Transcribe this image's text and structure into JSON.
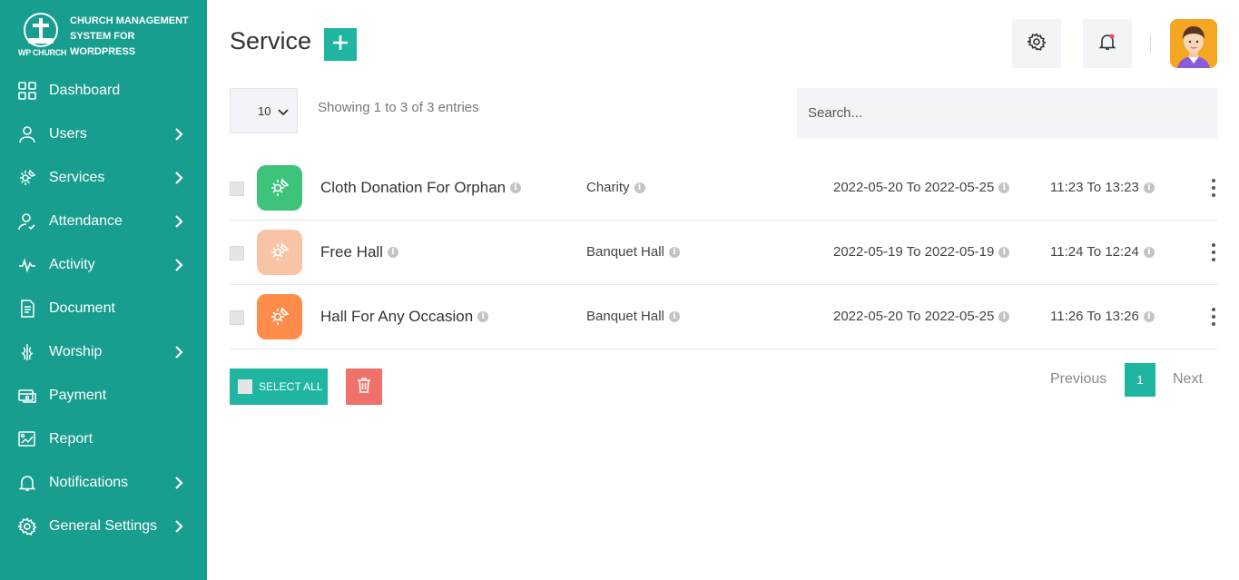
{
  "brand": {
    "logo_text": "WP CHURCH",
    "title": "CHURCH MANAGEMENT SYSTEM FOR WORDPRESS"
  },
  "sidebar": {
    "items": [
      {
        "label": "Dashboard",
        "icon": "dashboard-icon",
        "has_submenu": false
      },
      {
        "label": "Users",
        "icon": "user-icon",
        "has_submenu": true
      },
      {
        "label": "Services",
        "icon": "services-icon",
        "has_submenu": true
      },
      {
        "label": "Attendance",
        "icon": "attendance-icon",
        "has_submenu": true
      },
      {
        "label": "Activity",
        "icon": "activity-icon",
        "has_submenu": true
      },
      {
        "label": "Document",
        "icon": "document-icon",
        "has_submenu": false
      },
      {
        "label": "Worship",
        "icon": "worship-icon",
        "has_submenu": true
      },
      {
        "label": "Payment",
        "icon": "payment-icon",
        "has_submenu": false
      },
      {
        "label": "Report",
        "icon": "report-icon",
        "has_submenu": false
      },
      {
        "label": "Notifications",
        "icon": "bell-icon",
        "has_submenu": true
      },
      {
        "label": "General Settings",
        "icon": "gear-icon",
        "has_submenu": true
      }
    ]
  },
  "header": {
    "title": "Service",
    "add_icon": "plus-icon",
    "settings_icon": "gear-icon",
    "notification_icon": "bell-icon"
  },
  "table_controls": {
    "page_size": "10",
    "entries_info": "Showing 1 to 3 of 3 entries",
    "search_placeholder": "Search..."
  },
  "rows": [
    {
      "name": "Cloth Donation For Orphan",
      "category": "Charity",
      "dates": "2022-05-20 To 2022-05-25",
      "time": "11:23 To 13:23",
      "icon_color": "#3ec47a"
    },
    {
      "name": "Free Hall",
      "category": "Banquet Hall",
      "dates": "2022-05-19 To 2022-05-19",
      "time": "11:24 To 12:24",
      "icon_color": "#f9c3a5"
    },
    {
      "name": "Hall For Any Occasion",
      "category": "Banquet Hall",
      "dates": "2022-05-20 To 2022-05-25",
      "time": "11:26 To 13:26",
      "icon_color": "#ff8c4a"
    }
  ],
  "footer": {
    "select_all": "SELECT ALL",
    "delete_icon": "trash-icon",
    "previous": "Previous",
    "current_page": "1",
    "next": "Next"
  },
  "colors": {
    "sidebar": "#179e8e",
    "accent": "#1fb5a0",
    "danger": "#f0706a"
  }
}
